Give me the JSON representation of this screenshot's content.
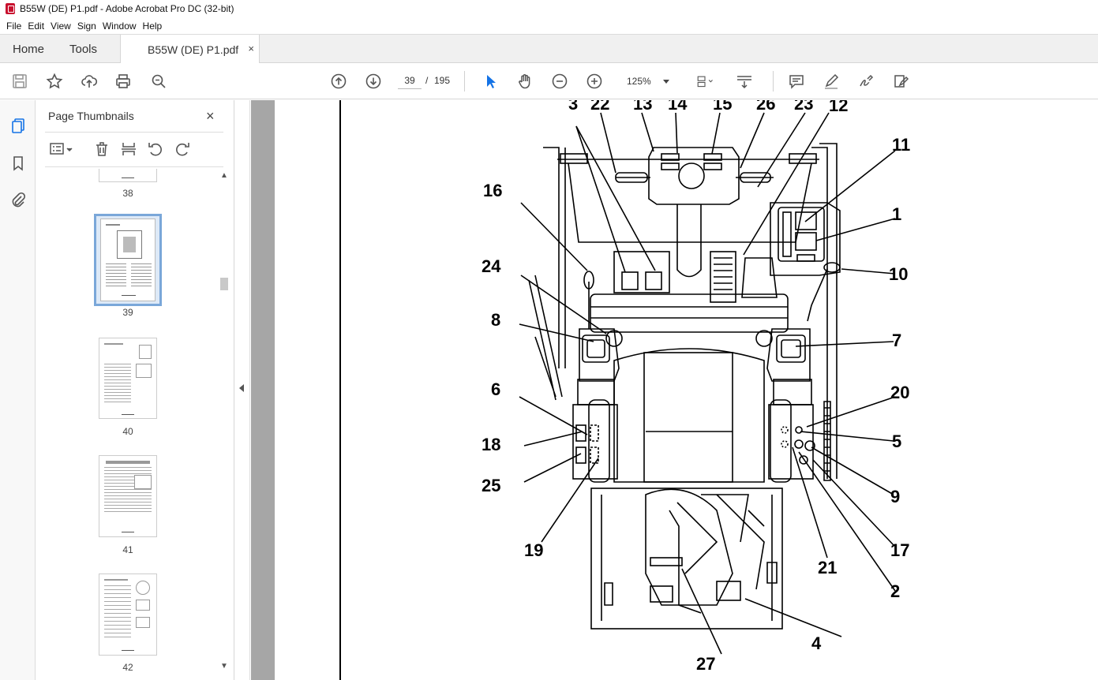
{
  "window": {
    "title": "B55W (DE) P1.pdf - Adobe Acrobat Pro DC (32-bit)"
  },
  "menubar": {
    "items": [
      "File",
      "Edit",
      "View",
      "Sign",
      "Window",
      "Help"
    ]
  },
  "tabs": {
    "home": "Home",
    "tools": "Tools",
    "document": "B55W (DE) P1.pdf",
    "close": "×"
  },
  "toolbar": {
    "page_current": "39",
    "page_sep": "/",
    "page_total": "195",
    "zoom": "125%",
    "icons": [
      "save-icon",
      "star-icon",
      "upload-icon",
      "print-icon",
      "search-zoom-icon",
      "page-up-icon",
      "page-down-icon",
      "zoom-out-icon",
      "zoom-in-icon",
      "select-cursor-icon",
      "hand-icon",
      "fit-page-icon",
      "scroll-mode-icon",
      "comment-icon",
      "highlight-icon",
      "sign-icon",
      "edit-pdf-icon"
    ]
  },
  "panel": {
    "title": "Page Thumbnails",
    "close": "×",
    "thumbnails": [
      {
        "label": "38"
      },
      {
        "label": "39",
        "selected": true
      },
      {
        "label": "40"
      },
      {
        "label": "41"
      },
      {
        "label": "42"
      }
    ]
  },
  "diagram": {
    "callouts": [
      "3",
      "22",
      "13",
      "14",
      "15",
      "26",
      "23",
      "12",
      "11",
      "1",
      "16",
      "24",
      "10",
      "8",
      "7",
      "6",
      "20",
      "18",
      "5",
      "25",
      "9",
      "19",
      "17",
      "21",
      "2",
      "4",
      "27"
    ]
  }
}
